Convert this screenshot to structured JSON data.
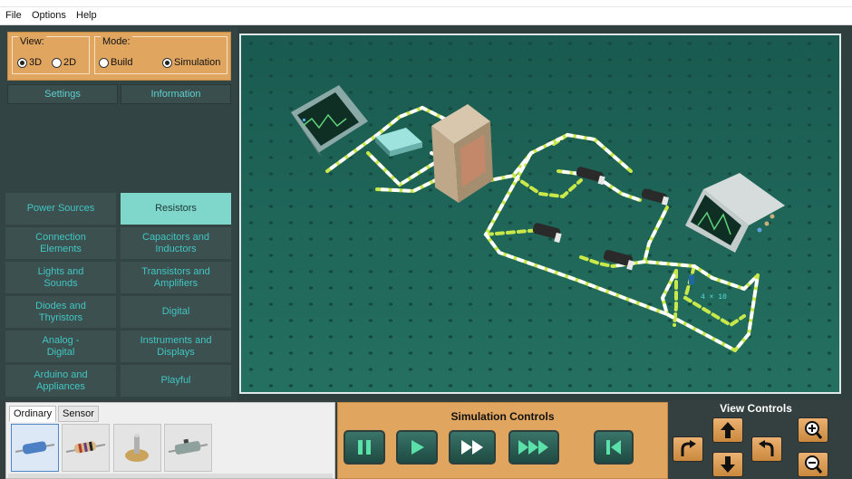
{
  "menu": [
    "File",
    "Options",
    "Help"
  ],
  "view_group": {
    "title": "View:",
    "options": [
      "3D",
      "2D"
    ],
    "selected": "3D"
  },
  "mode_group": {
    "title": "Mode:",
    "options": [
      "Build",
      "Simulation"
    ],
    "selected": "Simulation"
  },
  "top_buttons": [
    "Settings",
    "Information"
  ],
  "categories": [
    "Power Sources",
    "Resistors",
    "Connection\nElements",
    "Capacitors and\nInductors",
    "Lights and\nSounds",
    "Transistors and\nAmplifiers",
    "Diodes and\nThyristors",
    "Digital",
    "Analog -\nDigital",
    "Instruments and\nDisplays",
    "Arduino and\nAppliances",
    "Playful"
  ],
  "active_category": "Resistors",
  "parts_tabs": [
    "Ordinary",
    "Sensor"
  ],
  "active_parts_tab": "Ordinary",
  "parts": [
    "resistor-blue-icon",
    "resistor-banded-icon",
    "potentiometer-icon",
    "rheostat-icon"
  ],
  "selected_part": 0,
  "sim_controls": {
    "title": "Simulation Controls",
    "buttons": [
      "pause-icon",
      "play-icon",
      "fast-forward-icon",
      "faster-forward-icon",
      "rewind-icon"
    ]
  },
  "view_controls": {
    "title": "View Controls",
    "buttons": [
      "rotate-left-icon",
      "move-up-icon",
      "move-down-icon",
      "rotate-right-icon",
      "zoom-in-icon",
      "zoom-out-icon"
    ]
  },
  "viewport": {
    "probe_label": "4 × 10"
  },
  "colors": {
    "accent": "#e0a660",
    "panel": "#324544",
    "category_text": "#42c6c3",
    "active_category": "#7fd7cb",
    "board": "#1f6155"
  }
}
